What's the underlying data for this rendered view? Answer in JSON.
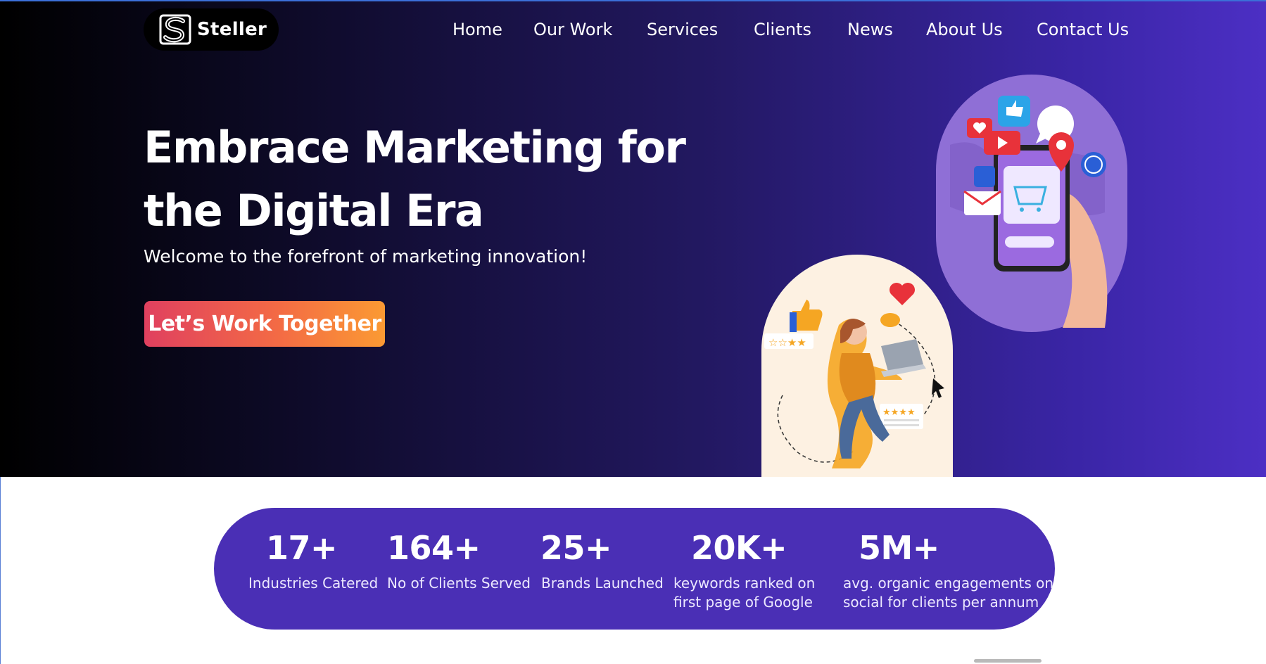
{
  "header": {
    "logo_text": "Steller",
    "nav": [
      {
        "label": "Home"
      },
      {
        "label": "Our Work"
      },
      {
        "label": "Services"
      },
      {
        "label": "Clients"
      },
      {
        "label": "News"
      },
      {
        "label": "About Us"
      },
      {
        "label": "Contact Us"
      }
    ]
  },
  "hero": {
    "headline_line1": "Embrace Marketing for",
    "headline_line2": "the Digital Era",
    "subheadline": "Welcome to the forefront of marketing innovation!",
    "cta_label": "Let’s Work Together"
  },
  "stats": [
    {
      "value": "17+",
      "label_line1": "Industries Catered",
      "label_line2": ""
    },
    {
      "value": "164+",
      "label_line1": "No of Clients Served",
      "label_line2": ""
    },
    {
      "value": "25+",
      "label_line1": "Brands Launched",
      "label_line2": ""
    },
    {
      "value": "20K+",
      "label_line1": "keywords ranked on",
      "label_line2": "first page of Google"
    },
    {
      "value": "5M+",
      "label_line1": "avg. organic engagements on",
      "label_line2": "social for clients per annum"
    }
  ],
  "colors": {
    "hero_gradient_start": "#000000",
    "hero_gradient_end": "#4c2fc4",
    "stats_band": "#4a2fb5",
    "cta_start": "#e0405f",
    "cta_end": "#fb9a33"
  },
  "icons": {
    "logo": "steller-s-logo",
    "phone_illustration": "smartphone-social-media-illustration",
    "girl_illustration": "girl-with-laptop-illustration"
  }
}
